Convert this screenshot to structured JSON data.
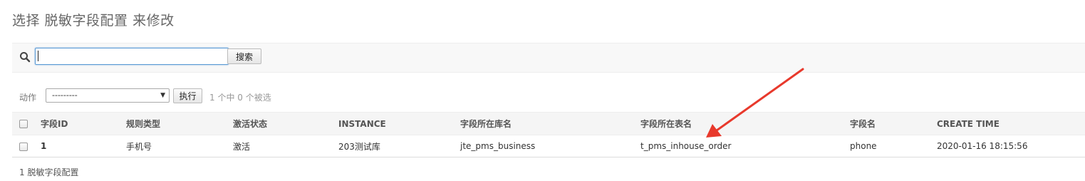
{
  "page": {
    "title": "选择 脱敏字段配置 来修改"
  },
  "search": {
    "value": "",
    "button_label": "搜索"
  },
  "actions": {
    "label": "动作",
    "selected_option": "---------",
    "run_label": "执行",
    "selection_counter": "1 个中 0 个被选"
  },
  "table": {
    "headers": [
      "字段ID",
      "规则类型",
      "激活状态",
      "INSTANCE",
      "字段所在库名",
      "字段所在表名",
      "字段名",
      "CREATE TIME"
    ],
    "rows": [
      {
        "id": "1",
        "rule_type": "手机号",
        "status": "激活",
        "instance": "203测试库",
        "db_name": "jte_pms_business",
        "table_name": "t_pms_inhouse_order",
        "field_name": "phone",
        "create_time": "2020-01-16 18:15:56"
      }
    ]
  },
  "footer": {
    "count_text": "1 脱敏字段配置"
  },
  "colors": {
    "annotation_arrow": "#e8392c",
    "input_focus_border": "#5b9bd5"
  }
}
